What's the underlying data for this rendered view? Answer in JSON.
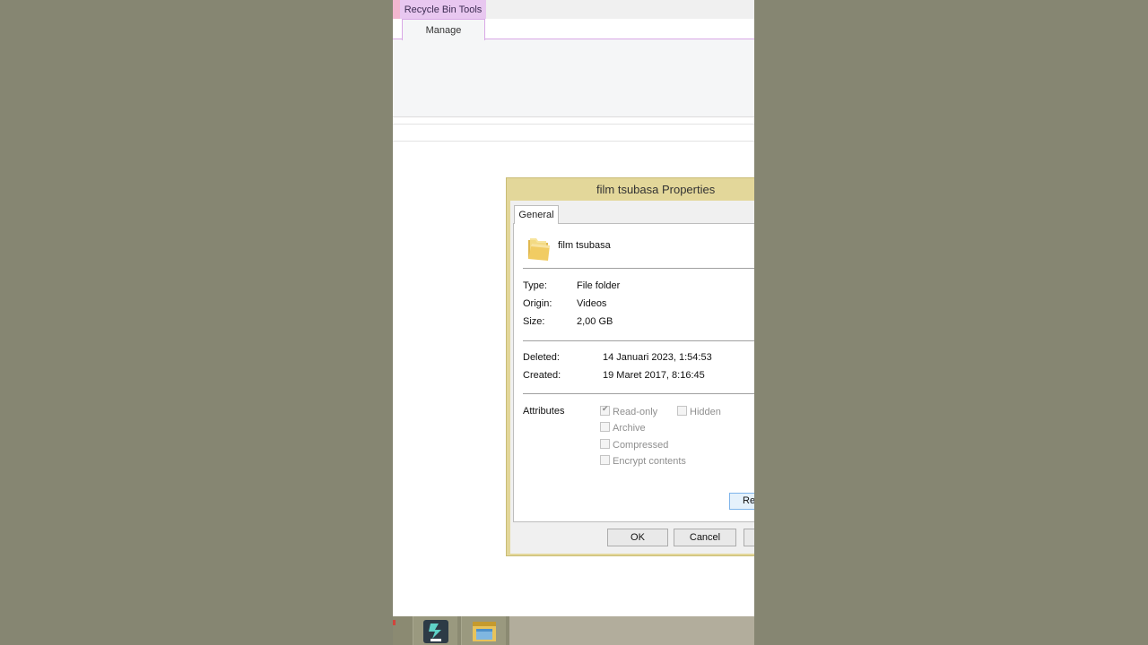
{
  "ribbon": {
    "context_tab": "Recycle Bin Tools",
    "active_tab": "Manage"
  },
  "dialog": {
    "title": "film tsubasa Properties",
    "tab": "General",
    "item_name": "film tsubasa",
    "fields": {
      "type_label": "Type:",
      "type_value": "File folder",
      "origin_label": "Origin:",
      "origin_value": "Videos",
      "size_label": "Size:",
      "size_value": "2,00 GB",
      "deleted_label": "Deleted:",
      "deleted_value": "14 Januari 2023, 1:54:53",
      "created_label": "Created:",
      "created_value": "19 Maret 2017, 8:16:45"
    },
    "attributes_label": "Attributes",
    "attributes": {
      "read_only": {
        "label": "Read-only",
        "checked": true
      },
      "hidden": {
        "label": "Hidden",
        "checked": false
      },
      "archive": {
        "label": "Archive",
        "checked": false
      },
      "compressed": {
        "label": "Compressed",
        "checked": false
      },
      "encrypt": {
        "label": "Encrypt contents",
        "checked": false
      }
    },
    "restore_button": "Re",
    "ok_button": "OK",
    "cancel_button": "Cancel"
  },
  "taskbar": {
    "icons": [
      "filmora-icon",
      "file-explorer-icon"
    ]
  }
}
